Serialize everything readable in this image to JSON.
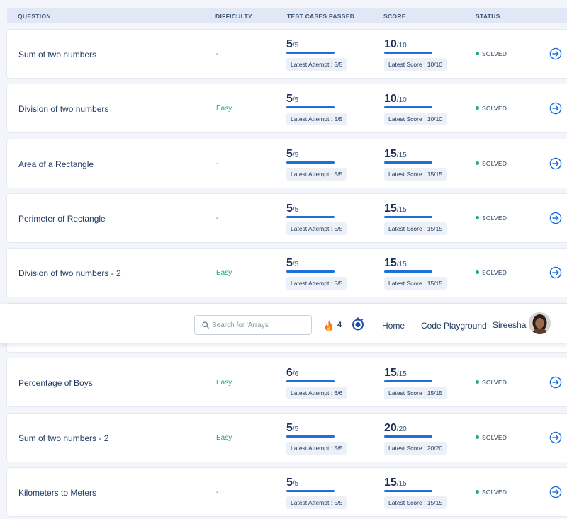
{
  "table": {
    "headers": {
      "question": "QUESTION",
      "difficulty": "DIFFICULTY",
      "tests": "TEST CASES PASSED",
      "score": "SCORE",
      "status": "STATUS"
    },
    "rows": [
      {
        "title": "Sum of two numbers",
        "difficulty": "-",
        "tests_passed": "5",
        "tests_total": "/5",
        "tests_latest": "Latest Attempt : 5/5",
        "score": "10",
        "score_total": "/10",
        "score_latest": "Latest Score : 10/10",
        "status": "SOLVED"
      },
      {
        "title": "Division of two numbers",
        "difficulty": "Easy",
        "tests_passed": "5",
        "tests_total": "/5",
        "tests_latest": "Latest Attempt : 5/5",
        "score": "10",
        "score_total": "/10",
        "score_latest": "Latest Score : 10/10",
        "status": "SOLVED"
      },
      {
        "title": "Area of a Rectangle",
        "difficulty": "-",
        "tests_passed": "5",
        "tests_total": "/5",
        "tests_latest": "Latest Attempt : 5/5",
        "score": "15",
        "score_total": "/15",
        "score_latest": "Latest Score : 15/15",
        "status": "SOLVED"
      },
      {
        "title": "Perimeter of Rectangle",
        "difficulty": "-",
        "tests_passed": "5",
        "tests_total": "/5",
        "tests_latest": "Latest Attempt : 5/5",
        "score": "15",
        "score_total": "/15",
        "score_latest": "Latest Score : 15/15",
        "status": "SOLVED"
      },
      {
        "title": "Division of two numbers - 2",
        "difficulty": "Easy",
        "tests_passed": "5",
        "tests_total": "/5",
        "tests_latest": "Latest Attempt : 5/5",
        "score": "15",
        "score_total": "/15",
        "score_latest": "Latest Score : 15/15",
        "status": "SOLVED"
      },
      {
        "title": "Percentage of Boys",
        "difficulty": "Easy",
        "tests_passed": "6",
        "tests_total": "/6",
        "tests_latest": "Latest Attempt : 6/6",
        "score": "15",
        "score_total": "/15",
        "score_latest": "Latest Score : 15/15",
        "status": "SOLVED"
      },
      {
        "title": "Sum of two numbers - 2",
        "difficulty": "Easy",
        "tests_passed": "5",
        "tests_total": "/5",
        "tests_latest": "Latest Attempt : 5/5",
        "score": "20",
        "score_total": "/20",
        "score_latest": "Latest Score : 20/20",
        "status": "SOLVED"
      },
      {
        "title": "Kilometers to Meters",
        "difficulty": "-",
        "tests_passed": "5",
        "tests_total": "/5",
        "tests_latest": "Latest Attempt : 5/5",
        "score": "15",
        "score_total": "/15",
        "score_latest": "Latest Score : 15/15",
        "status": "SOLVED"
      }
    ]
  },
  "navbar": {
    "search_placeholder": "Search for 'Arrays'",
    "streak_icon": "fire-icon",
    "streak_count": "4",
    "timer_icon": "stopwatch-icon",
    "home": "Home",
    "code_playground": "Code Playground",
    "user_name": "Sireesha"
  },
  "colors": {
    "header_bg": "#e1e7f5",
    "accent_blue": "#1e6fd9",
    "easy_green": "#1fae68",
    "solved_dot": "#1fae68"
  }
}
